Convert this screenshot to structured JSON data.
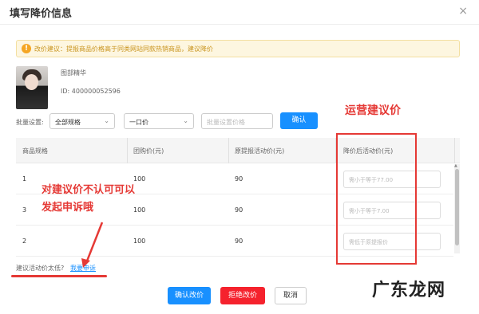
{
  "dialog": {
    "title": "填写降价信息",
    "close_label": "×"
  },
  "tip": {
    "icon": "exclamation-icon",
    "text": "改价建议：提报商品价格高于同类网站同款热销商品，建议降价"
  },
  "product": {
    "name": "图部精华",
    "id_text": "ID: 400000052596"
  },
  "batch": {
    "label": "批量设置:",
    "spec_select": "全部规格",
    "price_type_select": "一口价",
    "price_placeholder": "批量设置价格",
    "confirm_label": "确认"
  },
  "table": {
    "headers": [
      "商品规格",
      "团购价(元)",
      "原提报活动价(元)",
      "降价后活动价(元)"
    ],
    "rows": [
      {
        "spec": "1",
        "group_price": "100",
        "orig_price": "90",
        "placeholder": "需小于等于77.00"
      },
      {
        "spec": "3",
        "group_price": "100",
        "orig_price": "90",
        "placeholder": "需小于等于7.00"
      },
      {
        "spec": "2",
        "group_price": "100",
        "orig_price": "90",
        "placeholder": "需低于原提报价"
      }
    ]
  },
  "appeal": {
    "prefix": "建议活动价太低?",
    "link": "我要申诉"
  },
  "footer": {
    "confirm": "确认改价",
    "reject": "拒绝改价",
    "cancel": "取消"
  },
  "annotations": {
    "top_label": "运营建议价",
    "left_label": "对建议价不认可可以发起申诉哦",
    "color": "#e53935"
  },
  "watermark": "广东龙网",
  "colors": {
    "primary": "#1890ff",
    "danger": "#f5222d",
    "warning_bg": "#fdf6e0"
  }
}
